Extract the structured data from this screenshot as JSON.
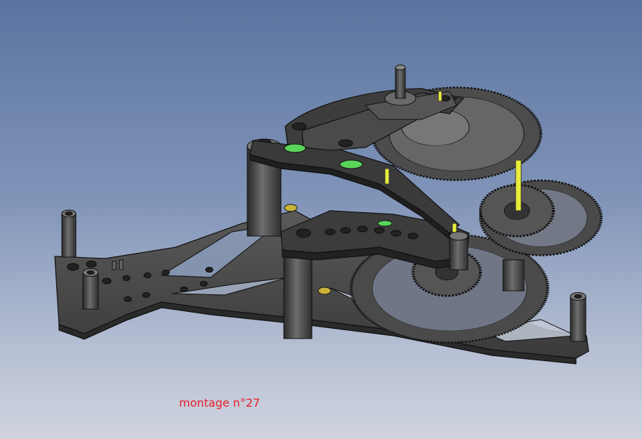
{
  "caption": {
    "text": "montage n°27"
  },
  "colors": {
    "caption": "#e8202a",
    "part_dark": "#3a3a3a",
    "part_mid": "#555555",
    "part_light": "#7a7a7a",
    "outline": "#111111",
    "washer": "#58d45a",
    "pin": "#e8ec3c",
    "screw": "#c9b23a"
  },
  "model": {
    "title": "",
    "parts": [
      "base-plate",
      "pillars",
      "upper-bridge",
      "lower-bridge",
      "gear-train",
      "escape-wheel",
      "arbor",
      "pins",
      "washers",
      "screws"
    ]
  }
}
